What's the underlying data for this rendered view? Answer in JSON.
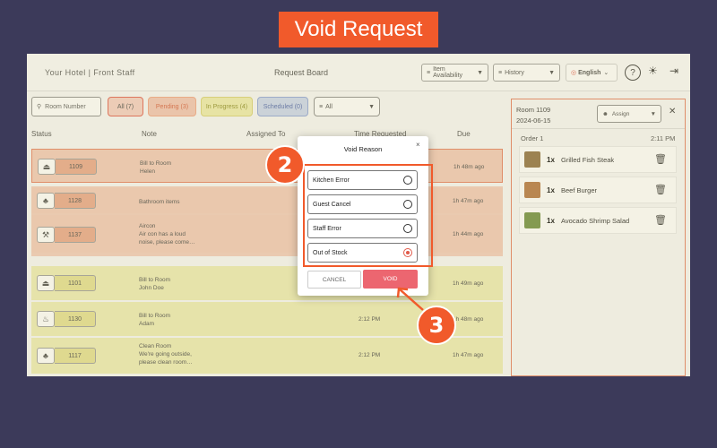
{
  "banner": "Void Request",
  "topbar": {
    "hotel": "Your Hotel | Front Staff",
    "board": "Request Board",
    "item_availability": "Item Availability",
    "history": "History",
    "language": "English",
    "help": "?",
    "theme": "☀",
    "logout": "⇥"
  },
  "filters": {
    "search_placeholder": "Room Number",
    "all": "All (7)",
    "pending": "Pending (3)",
    "in_progress": "In Progress (4)",
    "scheduled": "Scheduled (0)",
    "dropdown": "All"
  },
  "table": {
    "headers": [
      "Status",
      "Note",
      "Assigned To",
      "Time Requested",
      "Due"
    ],
    "rows": [
      {
        "icon": "bell-icon",
        "glyph": "⏏",
        "room": "1109",
        "note1": "Bill to Room",
        "note2": "Helen",
        "note3": "",
        "time": "",
        "due": "1h 48m ago"
      },
      {
        "icon": "cleaning-icon",
        "glyph": "♣",
        "room": "1128",
        "note1": "Bathroom items",
        "note2": "",
        "note3": "",
        "time": "",
        "due": "1h 47m ago"
      },
      {
        "icon": "wrench-icon",
        "glyph": "⚒",
        "room": "1137",
        "note1": "Aircon",
        "note2": "Air con has a loud",
        "note3": "noise, please come…",
        "time": "",
        "due": "1h 44m ago"
      },
      {
        "icon": "bell-icon",
        "glyph": "⏏",
        "room": "1101",
        "note1": "Bill to Room",
        "note2": "John Doe",
        "note3": "",
        "time": "",
        "due": "1h 49m ago"
      },
      {
        "icon": "food-icon",
        "glyph": "♨",
        "room": "1130",
        "note1": "Bill to Room",
        "note2": "Adam",
        "note3": "",
        "time": "2:12 PM",
        "due": "1h 48m ago"
      },
      {
        "icon": "cleaning-icon",
        "glyph": "♣",
        "room": "1117",
        "note1": "Clean Room",
        "note2": "We're going outside,",
        "note3": "please clean room…",
        "time": "2:12 PM",
        "due": "1h 47m ago"
      }
    ]
  },
  "panel": {
    "room": "Room 1109",
    "date": "2024-06-15",
    "assign": "Assign",
    "close": "✕",
    "order": "Order 1",
    "order_time": "2:11 PM",
    "items": [
      {
        "qty": "1x",
        "name": "Grilled Fish Steak",
        "color": "#8a6a3a"
      },
      {
        "qty": "1x",
        "name": "Beef Burger",
        "color": "#b0703a"
      },
      {
        "qty": "1x",
        "name": "Avocado Shrimp Salad",
        "color": "#6a8a3a"
      }
    ]
  },
  "modal": {
    "title": "Void Reason",
    "close": "×",
    "options": [
      "Kitchen Error",
      "Guest Cancel",
      "Staff Error",
      "Out of Stock"
    ],
    "selected": 3,
    "cancel": "CANCEL",
    "void": "VOID"
  },
  "steps": {
    "two": "2",
    "three": "3"
  },
  "colors": {
    "accent": "#f15a2b",
    "void_button": "#ec6670",
    "pending_row": "#f2c7b4",
    "progress_row": "#ecebb0"
  }
}
